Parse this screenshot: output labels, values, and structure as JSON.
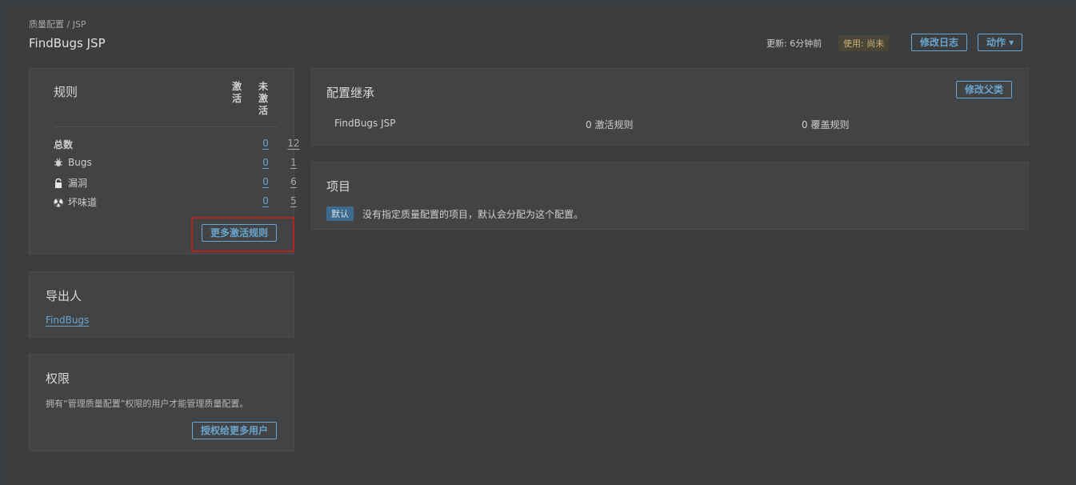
{
  "header": {
    "breadcrumb": "质量配置 / JSP",
    "title": "FindBugs JSP",
    "updated": "更新: 6分钟前",
    "usage": "使用: 尚未",
    "changelog_label": "修改日志",
    "actions_label": "动作 ▾"
  },
  "rules": {
    "title": "规则",
    "col_active": [
      "激",
      "活"
    ],
    "col_inactive": [
      "未",
      "激",
      "活"
    ],
    "rows": [
      {
        "label": "总数",
        "active": "0",
        "inactive": "12",
        "icon": "none"
      },
      {
        "label": "Bugs",
        "active": "0",
        "inactive": "1",
        "icon": "bug-icon"
      },
      {
        "label": "漏洞",
        "active": "0",
        "inactive": "6",
        "icon": "lock-icon"
      },
      {
        "label": "坏味道",
        "active": "0",
        "inactive": "5",
        "icon": "radiation-icon"
      }
    ],
    "more_button": "更多激活规则"
  },
  "exporters": {
    "title": "导出人",
    "link": "FindBugs"
  },
  "permissions": {
    "title": "权限",
    "description": "拥有“管理质量配置”权限的用户才能管理质量配置。",
    "grant_button": "授权给更多用户"
  },
  "inheritance": {
    "title": "配置继承",
    "change_parent_button": "修改父类",
    "profile": "FindBugs JSP",
    "active_rules": "0 激活规则",
    "overrides": "0 覆盖规则"
  },
  "projects": {
    "title": "项目",
    "default_badge": "默认",
    "note": "没有指定质量配置的项目，默认会分配为这个配置。"
  },
  "colors": {
    "accent": "#6aa5cf",
    "highlight": "#b3241f",
    "background": "#3c3d3e"
  }
}
